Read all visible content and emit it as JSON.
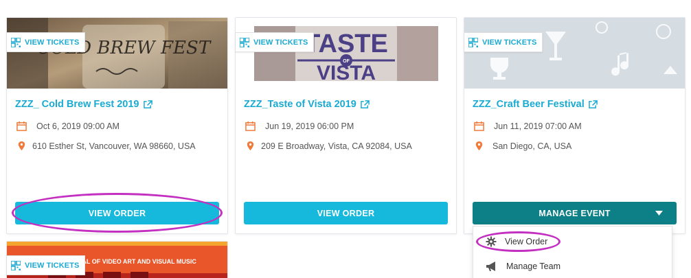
{
  "colors": {
    "accent": "#1aaad1",
    "button_cyan": "#16b9dc",
    "button_teal": "#0d7f86",
    "location_icon": "#f07a3a",
    "calendar_icon": "#f07a3a",
    "highlight": "#c32fc0"
  },
  "cards": [
    {
      "view_tickets": "VIEW TICKETS",
      "image_text": "COLD BREW FEST",
      "title": "ZZZ_ Cold Brew Fest 2019",
      "date": "Oct 6, 2019 09:00 AM",
      "location": "610 Esther St, Vancouver, WA 98660, USA",
      "button": "VIEW ORDER"
    },
    {
      "view_tickets": "VIEW TICKETS",
      "image_text_1": "TASTE",
      "image_text_of": "OF",
      "image_text_2": "VISTA",
      "title": "ZZZ_Taste of Vista 2019",
      "date": "Jun 19, 2019 06:00 PM",
      "location": "209 E Broadway, Vista, CA 92084, USA",
      "button": "VIEW ORDER"
    },
    {
      "view_tickets": "VIEW TICKETS",
      "title": "ZZZ_Craft Beer Festival",
      "date": "Jun 11, 2019 07:00 AM",
      "location": "San Diego, CA, USA",
      "button": "MANAGE EVENT",
      "dropdown": [
        {
          "label": "View Order",
          "icon": "gear-icon"
        },
        {
          "label": "Manage Team",
          "icon": "megaphone-icon"
        }
      ]
    },
    {
      "view_tickets": "VIEW TICKETS",
      "image_text": "ESTIVAL OF VIDEO ART AND VISUAL MUSIC"
    }
  ]
}
